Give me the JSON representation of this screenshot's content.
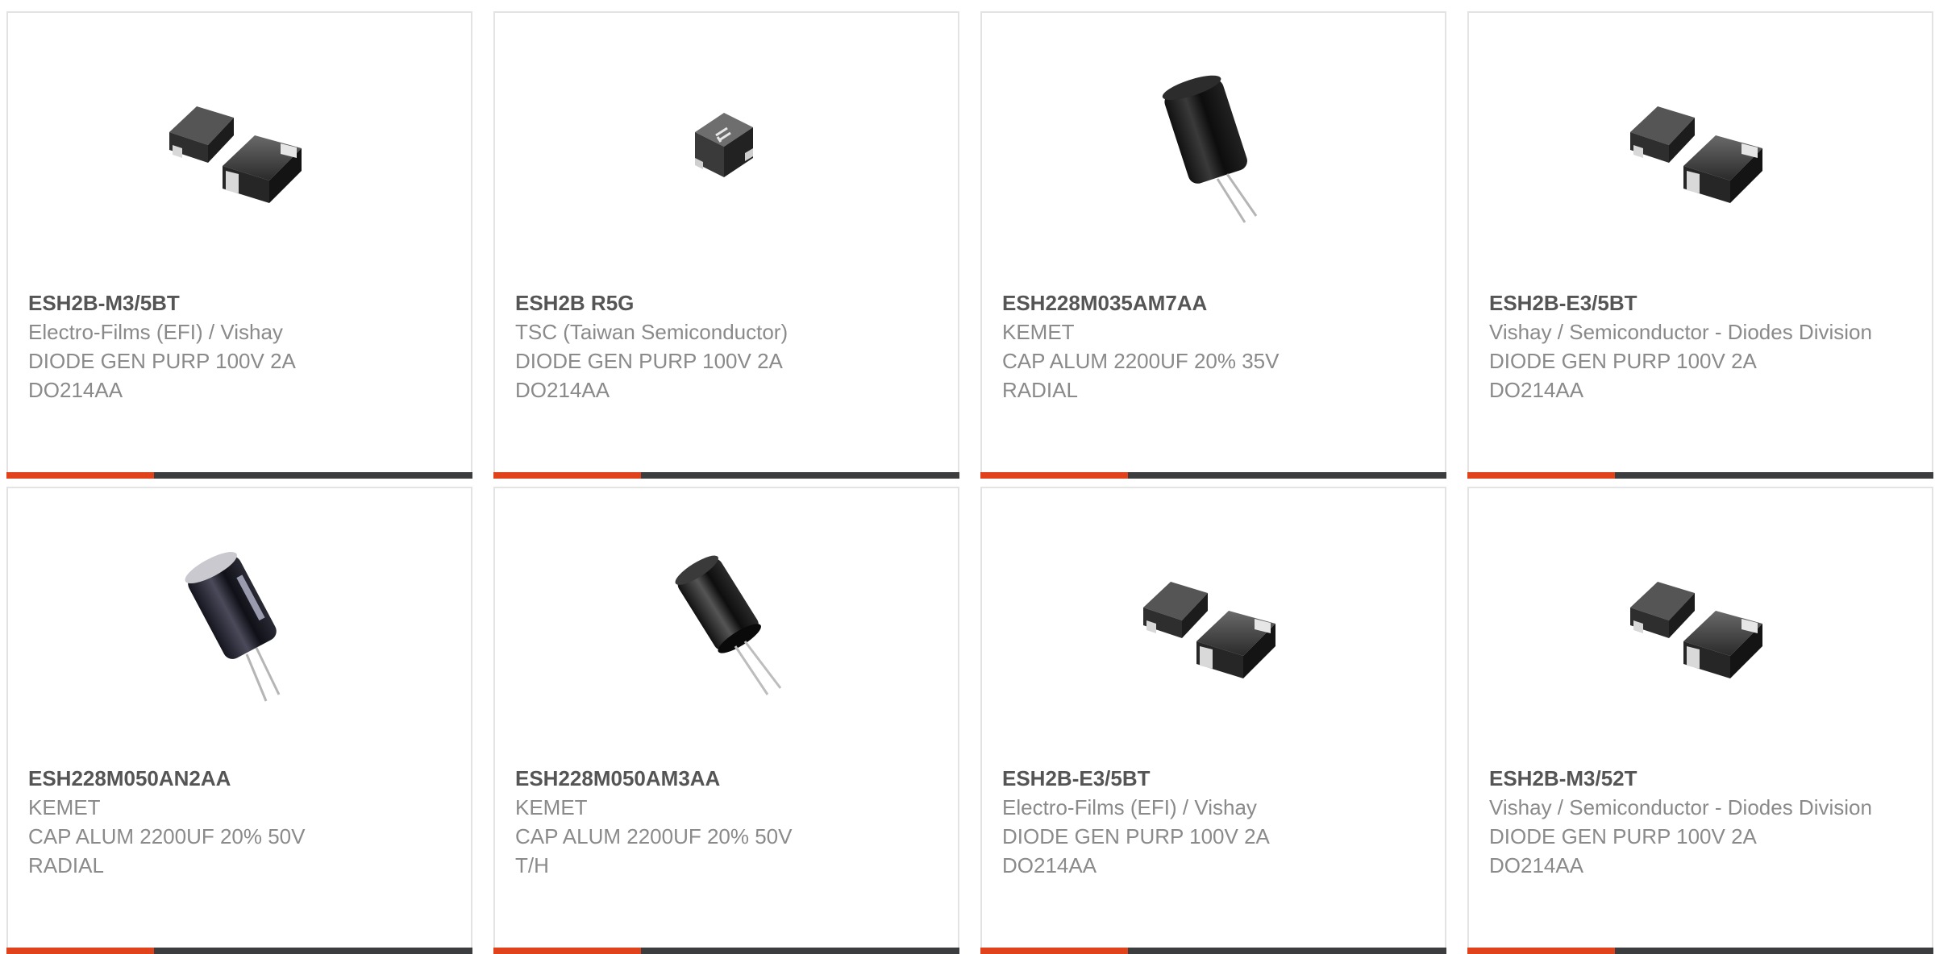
{
  "colors": {
    "accent": "#e0421b",
    "bar": "#3b3d3f",
    "border": "#e3e3e3",
    "part_number": "#555555",
    "text": "#8a8a8a"
  },
  "products": [
    {
      "part_number": "ESH2B-M3/5BT",
      "manufacturer": "Electro-Films (EFI) / Vishay",
      "description": "DIODE GEN PURP 100V 2A",
      "package": "DO214AA",
      "image_icon": "smd-diode-pair-icon"
    },
    {
      "part_number": "ESH2B R5G",
      "manufacturer": "TSC (Taiwan Semiconductor)",
      "description": "DIODE GEN PURP 100V 2A",
      "package": "DO214AA",
      "image_icon": "smd-diode-single-icon"
    },
    {
      "part_number": "ESH228M035AM7AA",
      "manufacturer": "KEMET",
      "description": "CAP ALUM 2200UF 20% 35V",
      "package": "RADIAL",
      "image_icon": "electrolytic-capacitor-icon"
    },
    {
      "part_number": "ESH2B-E3/5BT",
      "manufacturer": "Vishay / Semiconductor - Diodes Division",
      "description": "DIODE GEN PURP 100V 2A",
      "package": "DO214AA",
      "image_icon": "smd-diode-pair-icon"
    },
    {
      "part_number": "ESH228M050AN2AA",
      "manufacturer": "KEMET",
      "description": "CAP ALUM 2200UF 20% 50V",
      "package": "RADIAL",
      "image_icon": "electrolytic-capacitor-icon"
    },
    {
      "part_number": "ESH228M050AM3AA",
      "manufacturer": "KEMET",
      "description": "CAP ALUM 2200UF 20% 50V",
      "package": "T/H",
      "image_icon": "electrolytic-capacitor-icon"
    },
    {
      "part_number": "ESH2B-E3/5BT",
      "manufacturer": "Electro-Films (EFI) / Vishay",
      "description": "DIODE GEN PURP 100V 2A",
      "package": "DO214AA",
      "image_icon": "smd-diode-pair-icon"
    },
    {
      "part_number": "ESH2B-M3/52T",
      "manufacturer": "Vishay / Semiconductor - Diodes Division",
      "description": "DIODE GEN PURP 100V 2A",
      "package": "DO214AA",
      "image_icon": "smd-diode-pair-icon"
    }
  ]
}
